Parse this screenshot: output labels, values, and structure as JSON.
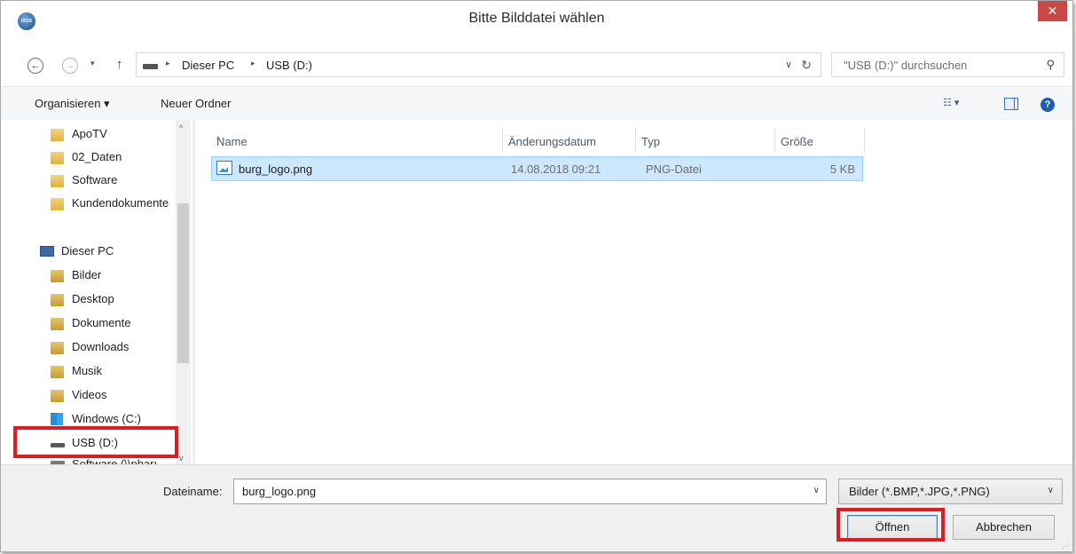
{
  "window": {
    "title": "Bitte Bilddatei wählen",
    "app_icon_text": "IXOS",
    "close_glyph": "✕"
  },
  "navigation": {
    "back_glyph": "←",
    "forward_glyph": "→",
    "recent_glyph": "▾",
    "up_glyph": "↑",
    "breadcrumbs": [
      "Dieser PC",
      "USB (D:)"
    ],
    "breadcrumb_sep": "▸",
    "dropdown_glyph": "∨",
    "refresh_glyph": "↻",
    "search_placeholder": "\"USB (D:)\" durchsuchen",
    "search_glyph": "⚲"
  },
  "commandbar": {
    "organize": "Organisieren ▾",
    "new_folder": "Neuer Ordner",
    "view_glyph": "☷ ▾",
    "help_glyph": "?"
  },
  "sidebar": {
    "items": [
      {
        "label": "ApoTV",
        "icon": "folder-icon"
      },
      {
        "label": "02_Daten",
        "icon": "folder-icon"
      },
      {
        "label": "Software",
        "icon": "folder-icon"
      },
      {
        "label": "Kundendokumente",
        "icon": "folder-icon"
      },
      {
        "label": "Dieser PC",
        "icon": "computer-icon"
      },
      {
        "label": "Bilder",
        "icon": "pictures-folder-icon"
      },
      {
        "label": "Desktop",
        "icon": "desktop-folder-icon"
      },
      {
        "label": "Dokumente",
        "icon": "documents-folder-icon"
      },
      {
        "label": "Downloads",
        "icon": "downloads-folder-icon"
      },
      {
        "label": "Musik",
        "icon": "music-folder-icon"
      },
      {
        "label": "Videos",
        "icon": "videos-folder-icon"
      },
      {
        "label": "Windows (C:)",
        "icon": "windows-drive-icon"
      },
      {
        "label": "USB (D:)",
        "icon": "usb-drive-icon"
      },
      {
        "label": "Software (\\\\pharı",
        "icon": "network-drive-icon"
      }
    ],
    "scroll_up_glyph": "^",
    "scroll_down_glyph": "v"
  },
  "filelist": {
    "columns": [
      "Name",
      "Änderungsdatum",
      "Typ",
      "Größe"
    ],
    "sort_glyph": "^",
    "rows": [
      {
        "name": "burg_logo.png",
        "date": "14.08.2018 09:21",
        "type": "PNG-Datei",
        "size": "5 KB"
      }
    ]
  },
  "footer": {
    "filename_label": "Dateiname:",
    "filename_value": "burg_logo.png",
    "filename_dd_glyph": "∨",
    "filter_value": "Bilder (*.BMP,*.JPG,*.PNG)",
    "filter_dd_glyph": "∨",
    "open_label": "Öffnen",
    "cancel_label": "Abbrechen",
    "grip_glyph": "⋰"
  },
  "colors": {
    "highlight": "#e01b22",
    "selection": "#cce8ff",
    "close_button": "#c74a46"
  }
}
